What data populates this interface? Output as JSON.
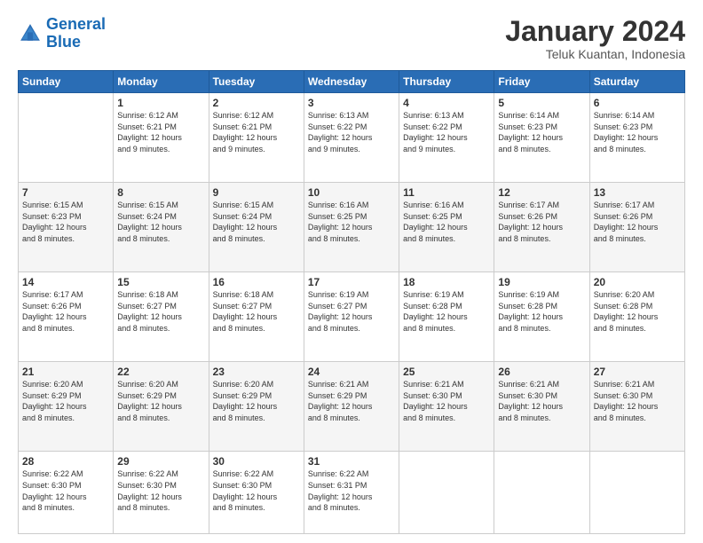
{
  "logo": {
    "line1": "General",
    "line2": "Blue"
  },
  "title": "January 2024",
  "subtitle": "Teluk Kuantan, Indonesia",
  "days_header": [
    "Sunday",
    "Monday",
    "Tuesday",
    "Wednesday",
    "Thursday",
    "Friday",
    "Saturday"
  ],
  "weeks": [
    [
      {
        "day": "",
        "sunrise": "",
        "sunset": "",
        "daylight": ""
      },
      {
        "day": "1",
        "sunrise": "Sunrise: 6:12 AM",
        "sunset": "Sunset: 6:21 PM",
        "daylight": "Daylight: 12 hours and 9 minutes."
      },
      {
        "day": "2",
        "sunrise": "Sunrise: 6:12 AM",
        "sunset": "Sunset: 6:21 PM",
        "daylight": "Daylight: 12 hours and 9 minutes."
      },
      {
        "day": "3",
        "sunrise": "Sunrise: 6:13 AM",
        "sunset": "Sunset: 6:22 PM",
        "daylight": "Daylight: 12 hours and 9 minutes."
      },
      {
        "day": "4",
        "sunrise": "Sunrise: 6:13 AM",
        "sunset": "Sunset: 6:22 PM",
        "daylight": "Daylight: 12 hours and 9 minutes."
      },
      {
        "day": "5",
        "sunrise": "Sunrise: 6:14 AM",
        "sunset": "Sunset: 6:23 PM",
        "daylight": "Daylight: 12 hours and 8 minutes."
      },
      {
        "day": "6",
        "sunrise": "Sunrise: 6:14 AM",
        "sunset": "Sunset: 6:23 PM",
        "daylight": "Daylight: 12 hours and 8 minutes."
      }
    ],
    [
      {
        "day": "7",
        "sunrise": "Sunrise: 6:15 AM",
        "sunset": "Sunset: 6:23 PM",
        "daylight": "Daylight: 12 hours and 8 minutes."
      },
      {
        "day": "8",
        "sunrise": "Sunrise: 6:15 AM",
        "sunset": "Sunset: 6:24 PM",
        "daylight": "Daylight: 12 hours and 8 minutes."
      },
      {
        "day": "9",
        "sunrise": "Sunrise: 6:15 AM",
        "sunset": "Sunset: 6:24 PM",
        "daylight": "Daylight: 12 hours and 8 minutes."
      },
      {
        "day": "10",
        "sunrise": "Sunrise: 6:16 AM",
        "sunset": "Sunset: 6:25 PM",
        "daylight": "Daylight: 12 hours and 8 minutes."
      },
      {
        "day": "11",
        "sunrise": "Sunrise: 6:16 AM",
        "sunset": "Sunset: 6:25 PM",
        "daylight": "Daylight: 12 hours and 8 minutes."
      },
      {
        "day": "12",
        "sunrise": "Sunrise: 6:17 AM",
        "sunset": "Sunset: 6:26 PM",
        "daylight": "Daylight: 12 hours and 8 minutes."
      },
      {
        "day": "13",
        "sunrise": "Sunrise: 6:17 AM",
        "sunset": "Sunset: 6:26 PM",
        "daylight": "Daylight: 12 hours and 8 minutes."
      }
    ],
    [
      {
        "day": "14",
        "sunrise": "Sunrise: 6:17 AM",
        "sunset": "Sunset: 6:26 PM",
        "daylight": "Daylight: 12 hours and 8 minutes."
      },
      {
        "day": "15",
        "sunrise": "Sunrise: 6:18 AM",
        "sunset": "Sunset: 6:27 PM",
        "daylight": "Daylight: 12 hours and 8 minutes."
      },
      {
        "day": "16",
        "sunrise": "Sunrise: 6:18 AM",
        "sunset": "Sunset: 6:27 PM",
        "daylight": "Daylight: 12 hours and 8 minutes."
      },
      {
        "day": "17",
        "sunrise": "Sunrise: 6:19 AM",
        "sunset": "Sunset: 6:27 PM",
        "daylight": "Daylight: 12 hours and 8 minutes."
      },
      {
        "day": "18",
        "sunrise": "Sunrise: 6:19 AM",
        "sunset": "Sunset: 6:28 PM",
        "daylight": "Daylight: 12 hours and 8 minutes."
      },
      {
        "day": "19",
        "sunrise": "Sunrise: 6:19 AM",
        "sunset": "Sunset: 6:28 PM",
        "daylight": "Daylight: 12 hours and 8 minutes."
      },
      {
        "day": "20",
        "sunrise": "Sunrise: 6:20 AM",
        "sunset": "Sunset: 6:28 PM",
        "daylight": "Daylight: 12 hours and 8 minutes."
      }
    ],
    [
      {
        "day": "21",
        "sunrise": "Sunrise: 6:20 AM",
        "sunset": "Sunset: 6:29 PM",
        "daylight": "Daylight: 12 hours and 8 minutes."
      },
      {
        "day": "22",
        "sunrise": "Sunrise: 6:20 AM",
        "sunset": "Sunset: 6:29 PM",
        "daylight": "Daylight: 12 hours and 8 minutes."
      },
      {
        "day": "23",
        "sunrise": "Sunrise: 6:20 AM",
        "sunset": "Sunset: 6:29 PM",
        "daylight": "Daylight: 12 hours and 8 minutes."
      },
      {
        "day": "24",
        "sunrise": "Sunrise: 6:21 AM",
        "sunset": "Sunset: 6:29 PM",
        "daylight": "Daylight: 12 hours and 8 minutes."
      },
      {
        "day": "25",
        "sunrise": "Sunrise: 6:21 AM",
        "sunset": "Sunset: 6:30 PM",
        "daylight": "Daylight: 12 hours and 8 minutes."
      },
      {
        "day": "26",
        "sunrise": "Sunrise: 6:21 AM",
        "sunset": "Sunset: 6:30 PM",
        "daylight": "Daylight: 12 hours and 8 minutes."
      },
      {
        "day": "27",
        "sunrise": "Sunrise: 6:21 AM",
        "sunset": "Sunset: 6:30 PM",
        "daylight": "Daylight: 12 hours and 8 minutes."
      }
    ],
    [
      {
        "day": "28",
        "sunrise": "Sunrise: 6:22 AM",
        "sunset": "Sunset: 6:30 PM",
        "daylight": "Daylight: 12 hours and 8 minutes."
      },
      {
        "day": "29",
        "sunrise": "Sunrise: 6:22 AM",
        "sunset": "Sunset: 6:30 PM",
        "daylight": "Daylight: 12 hours and 8 minutes."
      },
      {
        "day": "30",
        "sunrise": "Sunrise: 6:22 AM",
        "sunset": "Sunset: 6:30 PM",
        "daylight": "Daylight: 12 hours and 8 minutes."
      },
      {
        "day": "31",
        "sunrise": "Sunrise: 6:22 AM",
        "sunset": "Sunset: 6:31 PM",
        "daylight": "Daylight: 12 hours and 8 minutes."
      },
      {
        "day": "",
        "sunrise": "",
        "sunset": "",
        "daylight": ""
      },
      {
        "day": "",
        "sunrise": "",
        "sunset": "",
        "daylight": ""
      },
      {
        "day": "",
        "sunrise": "",
        "sunset": "",
        "daylight": ""
      }
    ]
  ]
}
